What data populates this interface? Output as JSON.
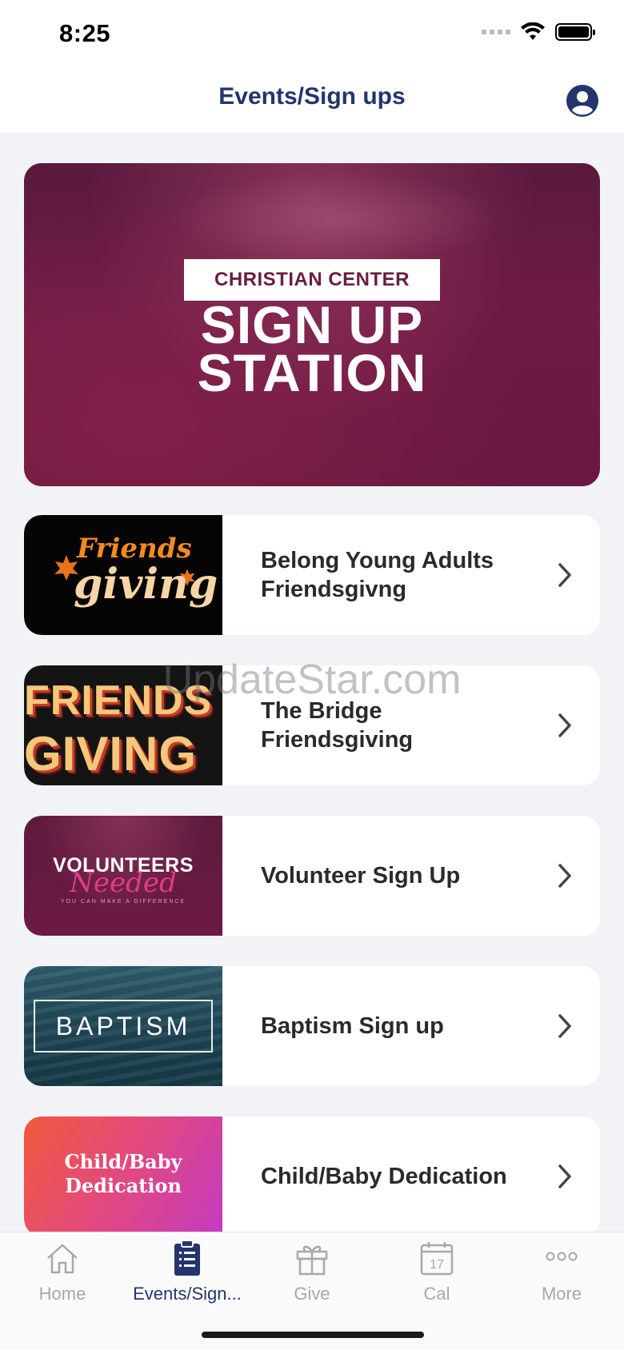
{
  "status_bar": {
    "time": "8:25"
  },
  "header": {
    "title": "Events/Sign ups",
    "profile_icon": "person-circle-icon"
  },
  "hero": {
    "label": "CHRISTIAN CENTER",
    "title_line1": "SIGN UP",
    "title_line2": "STATION"
  },
  "items": [
    {
      "label": "Belong Young Adults Friendsgivng",
      "thumb_text1": "Friends",
      "thumb_text2": "giving"
    },
    {
      "label": "The Bridge Friendsgiving",
      "thumb_text1": "FRIENDS",
      "thumb_text2": "GIVING"
    },
    {
      "label": "Volunteer Sign Up",
      "thumb_text1": "VOLUNTEERS",
      "thumb_text2": "Needed",
      "thumb_text3": "YOU CAN MAKE A DIFFERENCE"
    },
    {
      "label": "Baptism Sign up",
      "thumb_text1": "BAPTISM"
    },
    {
      "label": "Child/Baby Dedication",
      "thumb_text1": "Child/Baby",
      "thumb_text2": "Dedication"
    }
  ],
  "watermark": "UpdateStar.com",
  "tabs": [
    {
      "label": "Home",
      "icon": "house-icon"
    },
    {
      "label": "Events/Sign...",
      "icon": "clipboard-icon"
    },
    {
      "label": "Give",
      "icon": "gift-icon"
    },
    {
      "label": "Cal",
      "icon": "calendar-icon",
      "calendar_day": "17"
    },
    {
      "label": "More",
      "icon": "more-dots-icon"
    }
  ],
  "colors": {
    "accent": "#24356d",
    "inactive": "#a8a8a8",
    "hero": "#6e1b45"
  }
}
